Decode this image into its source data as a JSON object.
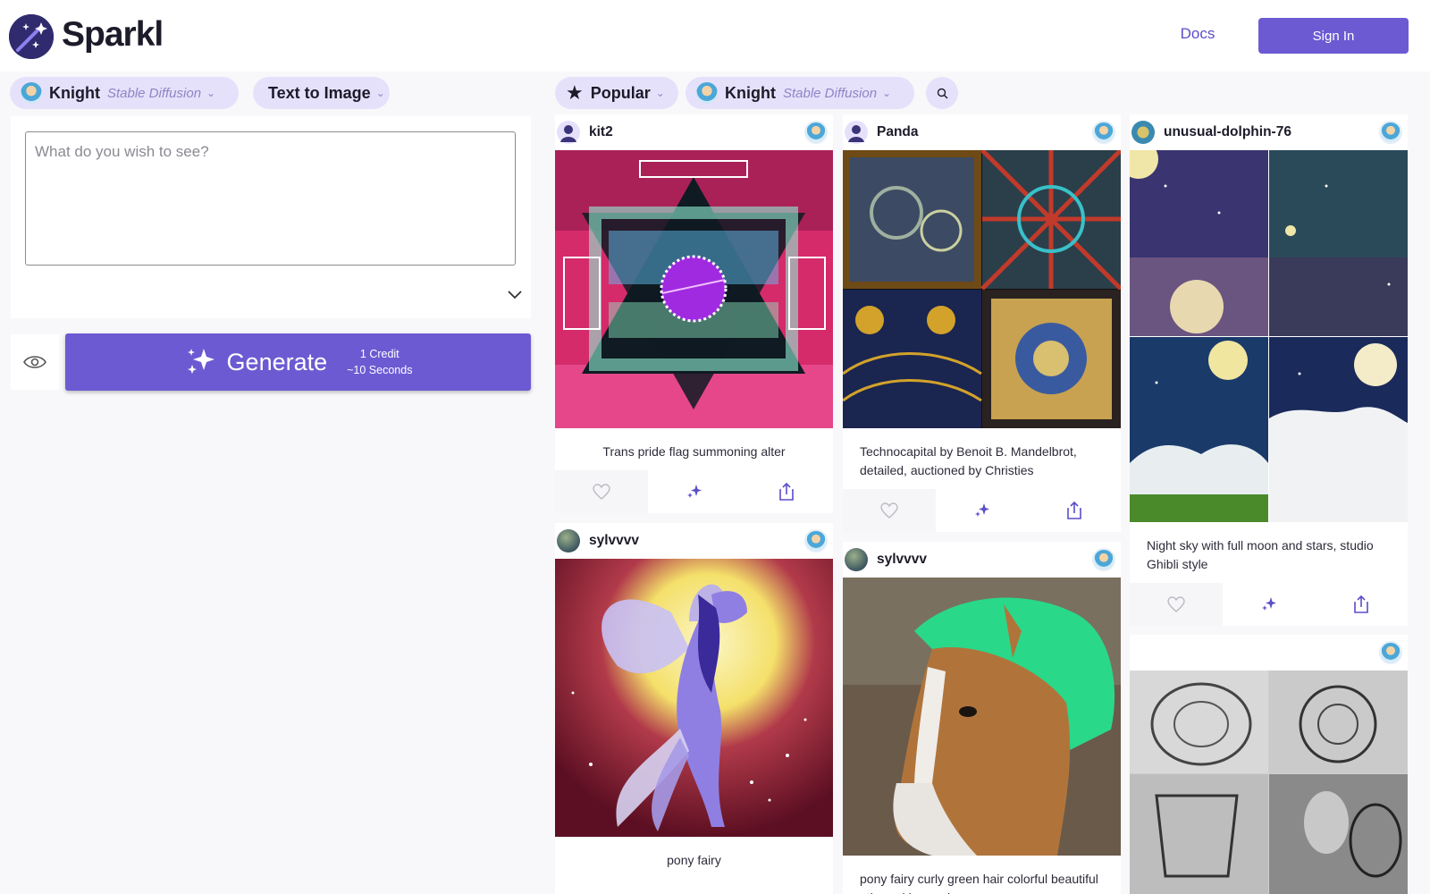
{
  "header": {
    "brand": "Sparkl",
    "docs_label": "Docs",
    "signin_label": "Sign In",
    "accent_color": "#6c5ad3"
  },
  "generator": {
    "model_pill": {
      "name": "Knight",
      "engine": "Stable Diffusion"
    },
    "mode_pill": {
      "label": "Text to Image"
    },
    "prompt_placeholder": "What do you wish to see?",
    "prompt_value": "",
    "generate_label": "Generate",
    "credit_text": "1 Credit",
    "time_text": "~10 Seconds"
  },
  "feed_filters": {
    "sort_pill": {
      "label": "Popular",
      "icon": "star-icon"
    },
    "model_pill": {
      "name": "Knight",
      "engine": "Stable Diffusion"
    },
    "search_icon": "search-icon"
  },
  "feed": {
    "card1": {
      "user": "kit2",
      "caption": "Trans pride flag summoning alter"
    },
    "card2": {
      "user": "sylvvvv",
      "caption": "pony fairy"
    },
    "card3": {
      "user": "Panda",
      "caption": "Technocapital by Benoit B. Mandelbrot, detailed, auctioned by Christies"
    },
    "card4": {
      "user": "sylvvvv",
      "caption": "pony fairy curly green hair colorful beautiful ethereal horse drawn"
    },
    "card5": {
      "user": "unusual-dolphin-76",
      "caption": "Night sky with full moon and stars, studio Ghibli style"
    },
    "card6": {
      "user": "",
      "caption": ""
    }
  },
  "icons": {
    "like": "heart-icon",
    "remix": "sparkles-icon",
    "share": "share-icon",
    "preview": "eye-icon",
    "expand": "chevron-down-icon"
  }
}
